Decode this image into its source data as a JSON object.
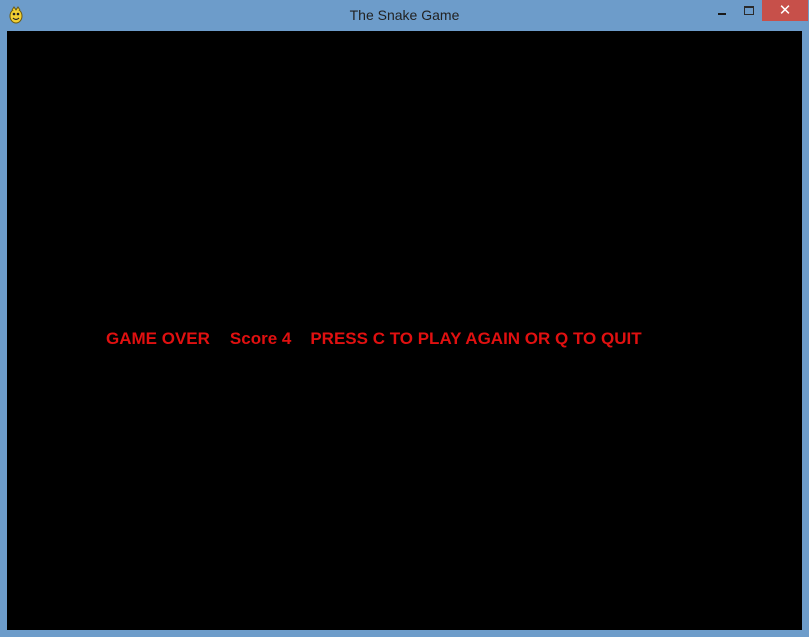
{
  "window": {
    "title": "The Snake Game",
    "close_label": "✕"
  },
  "game": {
    "status": "GAME OVER",
    "score_text": "Score 4",
    "instructions": "PRESS C TO PLAY AGAIN OR Q TO QUIT"
  },
  "colors": {
    "message": "#e01010",
    "background": "#000000",
    "frame": "#6d9cca"
  },
  "icons": {
    "app": "pygame-snake-icon",
    "minimize": "minimize-icon",
    "maximize": "maximize-icon",
    "close": "close-icon"
  }
}
